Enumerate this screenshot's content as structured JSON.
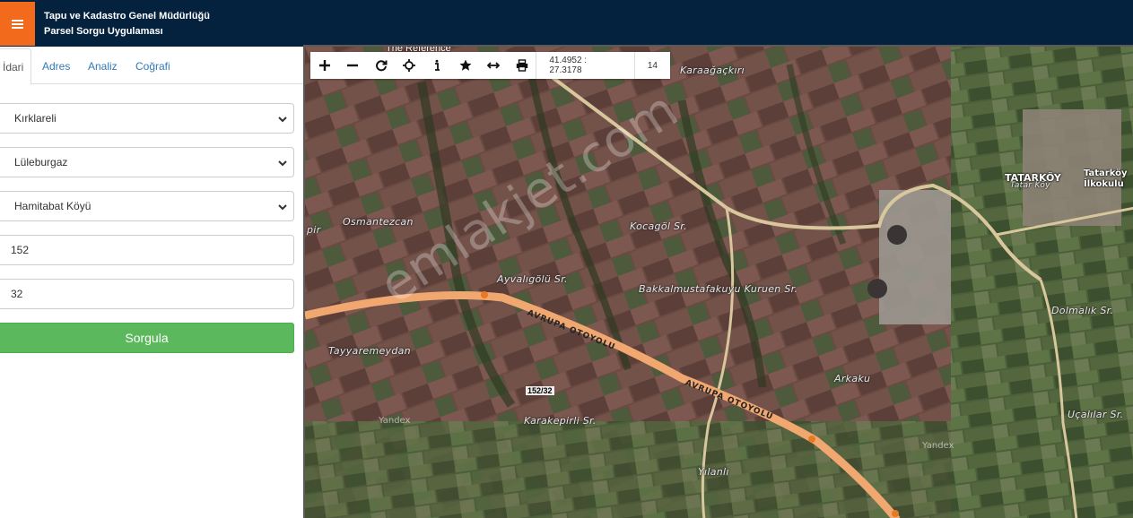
{
  "header": {
    "menu_icon": "hamburger-icon",
    "title_line1": "Tapu ve Kadastro Genel Müdürlüğü",
    "title_line2": "Parsel Sorgu Uygulaması",
    "accent_color": "#f26b1d",
    "bar_color": "#04213d"
  },
  "tabs": [
    {
      "label": "İdari",
      "active": true
    },
    {
      "label": "Adres",
      "active": false
    },
    {
      "label": "Analiz",
      "active": false
    },
    {
      "label": "Coğrafi",
      "active": false
    }
  ],
  "form": {
    "il": "Kırklareli",
    "ilce": "Lüleburgaz",
    "mahalle": "Hamitabat Köyü",
    "ada": "152",
    "parsel": "32",
    "submit_label": "Sorgula",
    "submit_color": "#5cb85c"
  },
  "map": {
    "toolbar": {
      "tools": [
        "zoom-in-icon",
        "zoom-out-icon",
        "refresh-icon",
        "locate-icon",
        "info-icon",
        "star-icon",
        "measure-icon",
        "print-icon"
      ],
      "coordinates": "41.4952 : 27.3178",
      "zoom_level": "14"
    },
    "top_cut_label": "The Reference",
    "labels": {
      "karaagackiri": "Karaağaçkırı",
      "osmantezcan": "Osmantezcan",
      "pir": "pir",
      "kocagol": "Kocagöl Sr.",
      "ayvaligolu": "Ayvalıgölü Sr.",
      "bakkal": "Bakkalmustafakuyu Kuruen Sr.",
      "tayyaremeydan": "Tayyaremeydan",
      "karakepirli": "Karakepirli Sr.",
      "arkaku": "Arkaku",
      "yilanli": "Yılanlı",
      "dolmalik": "Dolmalık Sr.",
      "ucalilar": "Uçalılar Sr.",
      "tatarkoy": "TATARKÖY",
      "tatarkoy_sub": "Tatar Köy",
      "tatarkoy_school": "Tatarköy İlkokulu"
    },
    "road_labels": [
      "AVRUPA OTOYOLU",
      "AVRUPA OTOYOLU"
    ],
    "parcel_label": "152/32",
    "watermark": "emlakjet.com",
    "yandex": "Yandex"
  }
}
